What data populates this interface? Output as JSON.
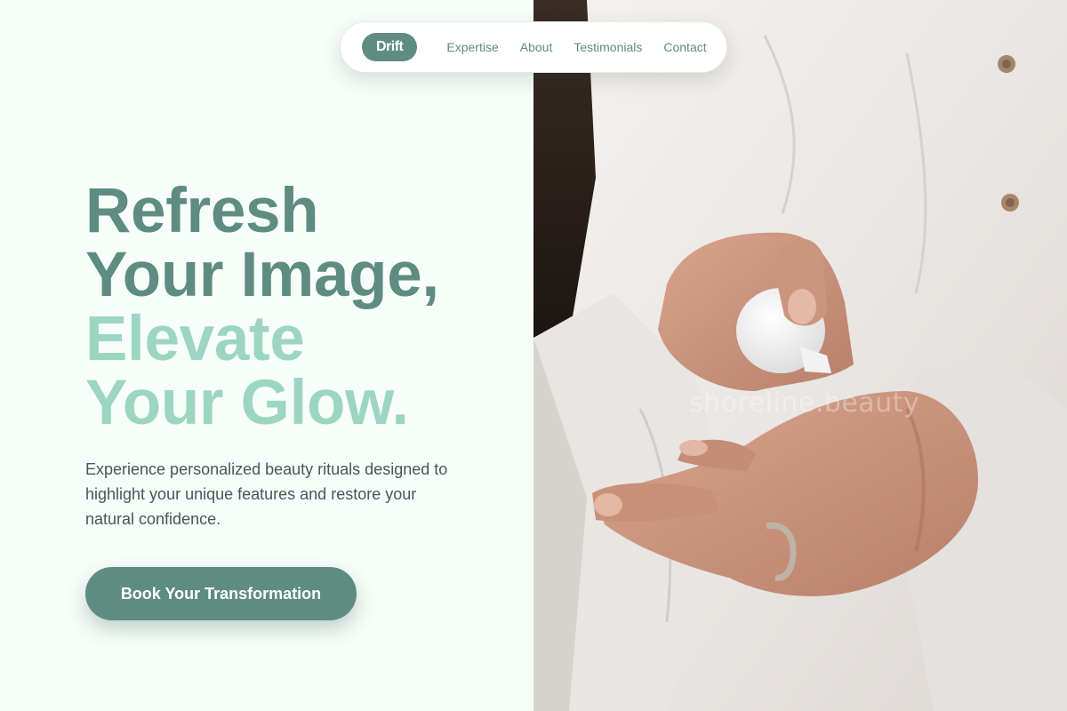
{
  "nav": {
    "brand": "Drift",
    "links": [
      "Expertise",
      "About",
      "Testimonials",
      "Contact"
    ]
  },
  "hero": {
    "headline": {
      "line1": "Refresh",
      "line2": "Your Image,",
      "line3": "Elevate",
      "line4": "Your Glow."
    },
    "description": "Experience personalized beauty rituals designed to highlight your unique features and restore your natural confidence.",
    "cta_label": "Book Your Transformation",
    "image_watermark": "shoreline.beauty"
  },
  "colors": {
    "accent": "#5e8c80",
    "accent_light": "#9cd5c3",
    "background": "#f7fdf9",
    "body_text": "#4a5559"
  }
}
